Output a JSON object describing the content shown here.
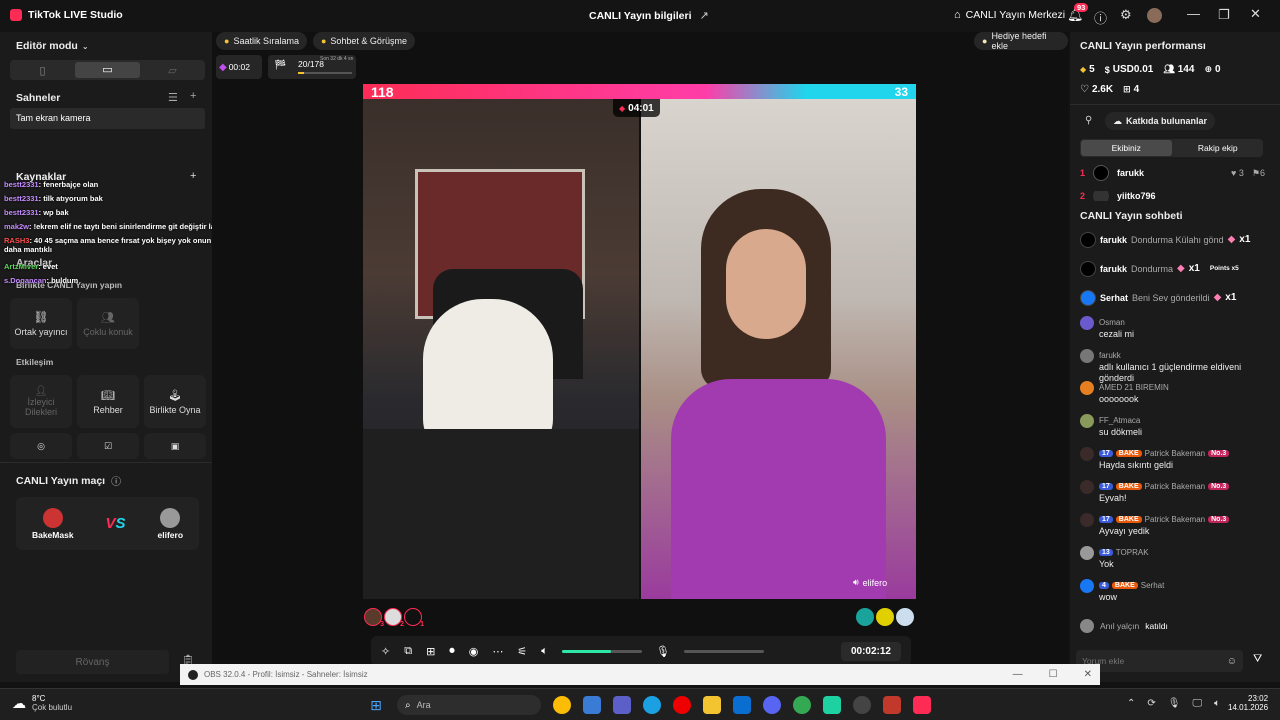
{
  "titlebar": {
    "app_name": "TikTok LIVE Studio",
    "center_title": "CANLI Yayın bilgileri",
    "live_center": "CANLI Yayın Merkezi",
    "notif_count": "93"
  },
  "left": {
    "editor_mode": "Editör modu",
    "scenes_title": "Sahneler",
    "scene_item": "Tam ekran kamera",
    "sources_title": "Kaynaklar",
    "tools_title": "Araçlar",
    "live_together": "Birlikte CANLI Yayın yapın",
    "co_host": "Ortak yayıncı",
    "multi_guest": "Çoklu konuk",
    "interaction": "Etkileşim",
    "viewer_requests": "İzleyici Dilekleri",
    "guide": "Rehber",
    "play_together": "Birlikte Oyna",
    "match_title": "CANLI Yayın maçı",
    "player1": "BakeMask",
    "player2": "elifero",
    "rematch": "Rövanş",
    "overlay_chat": [
      {
        "user": "bestt2331",
        "msg": ": fenerbajçe olan"
      },
      {
        "user": "bestt2331",
        "msg": ": tilk atıyorum bak"
      },
      {
        "user": "bestt2331",
        "msg": ": wp bak"
      },
      {
        "user": "mak2w",
        "msg": ": !ekrem elif ne taytı beni sinirlendirme git değiştir lan onu ben muho"
      },
      {
        "user": "RASH3",
        "msg": ": 40 45 saçma ama bence fırsat yok bişey yok onun yerine hafif riskli mathys tel tarzı daha mantıklı"
      },
      {
        "user": "ArtzMiver",
        "msg": ": evet"
      },
      {
        "user": "s.Dogancan",
        "msg": ": buldum"
      }
    ]
  },
  "center": {
    "top_pills": [
      "Saatlik Sıralama",
      "Sohbet & Görüşme"
    ],
    "gift_goal": "Hediye hedefi ekle",
    "timer_small": "00:02",
    "progress_text": "20/178",
    "progress_sub": "Son 32 dk 4 sn",
    "score_left": "118",
    "score_right": "33",
    "battle_timer": "04:01",
    "guest_label": "elifero",
    "elapsed": "00:02:12",
    "volume_level": 0.7,
    "ranks": [
      "3",
      "2",
      "1"
    ]
  },
  "right": {
    "perf_title": "CANLI Yayın performansı",
    "stats": [
      "5",
      "USD0.01",
      "144",
      "0",
      "2.6K",
      "4"
    ],
    "contributors": "Katkıda bulunanlar",
    "tab_team": "Ekibiniz",
    "tab_rival": "Rakip ekip",
    "rank_user1": "farukk",
    "rank_user1_likes": "3",
    "rank_user1_extra": "6",
    "rank_user2": "yiitko796",
    "chat_title": "CANLI Yayın sohbeti",
    "gifts": [
      {
        "user": "farukk",
        "text": "Dondurma Külahı gönd",
        "count": "x1"
      },
      {
        "user": "farukk",
        "text": "Dondurma",
        "count": "x1",
        "points": "Points x5"
      },
      {
        "user": "Serhat",
        "text": "Beni Sev gönderildi",
        "count": "x1"
      }
    ],
    "chat": [
      {
        "user": "Osman",
        "msg": "cezali mi"
      },
      {
        "user": "farukk",
        "msg": "adlı kullanıcı 1 güçlendirme eldiveni gönderdi"
      },
      {
        "user": "AMED 21 BIREMIN",
        "msg": "oooooook"
      },
      {
        "user": "FF_Atmaca",
        "msg": "su dökmeli"
      },
      {
        "user": "Patrick Bakeman",
        "msg": "Hayda sıkıntı geldi",
        "level": "17",
        "team": "BAKE",
        "rank": "No.3"
      },
      {
        "user": "Patrick Bakeman",
        "msg": "Eyvah!",
        "level": "17",
        "team": "BAKE",
        "rank": "No.3"
      },
      {
        "user": "Patrick Bakeman",
        "msg": "Ayvayı yedik",
        "level": "17",
        "team": "BAKE",
        "rank": "No.3"
      },
      {
        "user": "TOPRAK",
        "msg": "Yok",
        "level": "13"
      },
      {
        "user": "Serhat",
        "msg": "wow",
        "level": "4",
        "team": "BAKE"
      }
    ],
    "joined_user": "Anıl yalçın",
    "joined_text": "katıldı",
    "comment_placeholder": "Yorum ekle"
  },
  "obs": {
    "title": "OBS 32.0.4 - Profil: İsimsiz - Sahneler: İsimsiz"
  },
  "taskbar": {
    "weather_temp": "8°C",
    "weather_desc": "Çok bulutlu",
    "search_placeholder": "Ara",
    "time": "23:02",
    "date": "14.01.2026"
  },
  "colors": {
    "pink": "#fe2c55",
    "cyan": "#20d5ec",
    "progress_green": "#2ee6a6"
  }
}
